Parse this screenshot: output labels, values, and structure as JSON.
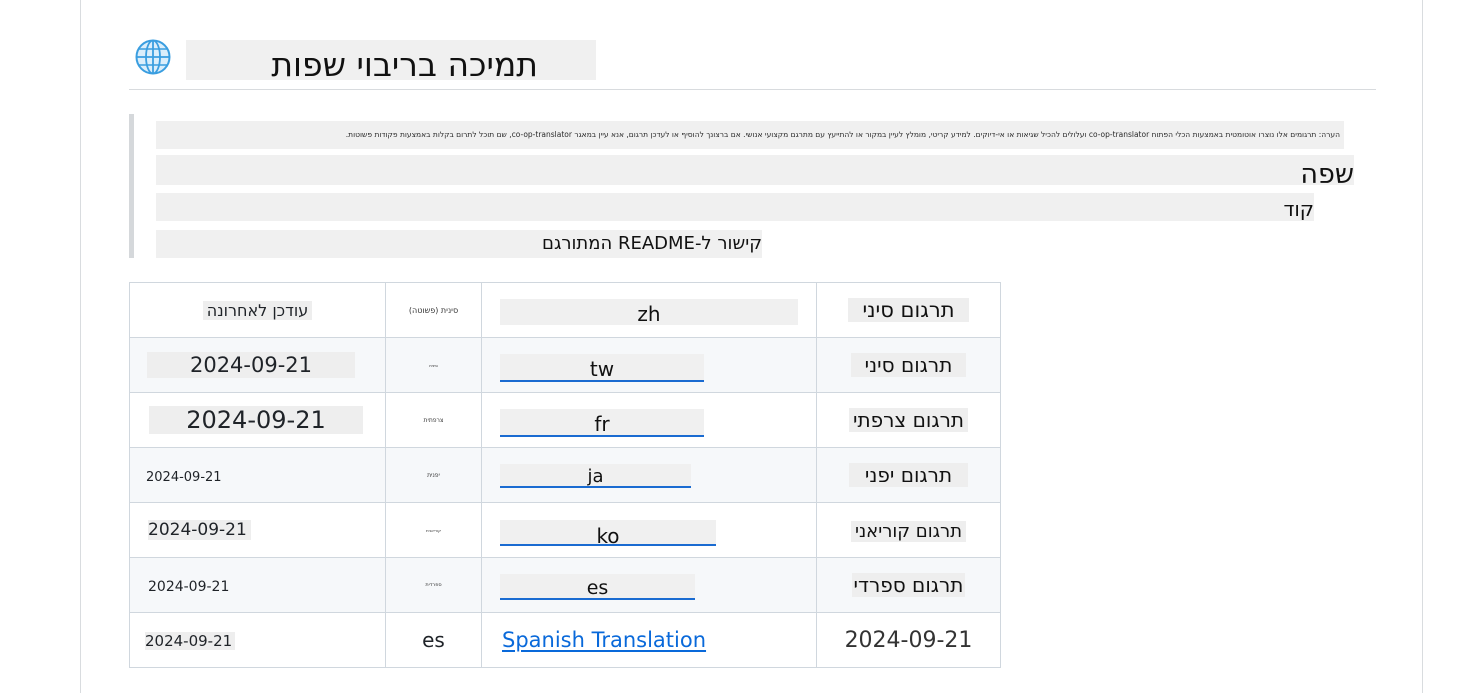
{
  "heading": {
    "icon": "globe-icon",
    "text": "תמיכה בריבוי שפות"
  },
  "note": "הערה: תרגומים אלו נוצרו אוטומטית באמצעות הכלי הפתוח co-op-translator ועלולים להכיל שגיאות או אי-דיוקים. למידע קריטי, מומלץ לעיין במקור או להתייעץ עם מתרגם מקצועי אנושי. אם ברצונך להוסיף או לעדכן תרגום, אנא עיין במאגר co-op-translator, שם תוכל לתרום בקלות באמצעות פקודות פשוטות.",
  "columns": {
    "language": "שפה",
    "code": "קוד",
    "link": "קישור ל-README המתורגם"
  },
  "table": {
    "header": {
      "updated": "עודכן לאחרונה",
      "tiny": "סינית (פשוטה)",
      "code": "zh",
      "name": "תרגום סיני"
    },
    "rows": [
      {
        "date": "2024-09-21",
        "tiny": "סינית",
        "code": "tw",
        "name": "תרגום סיני"
      },
      {
        "date": "2024-09-21",
        "tiny": "צרפתית",
        "code": "fr",
        "name": "תרגום צרפתי"
      },
      {
        "date": "2024-09-21",
        "tiny": "יפנית",
        "code": "ja",
        "name": "תרגום יפני"
      },
      {
        "date": "2024-09-21",
        "tiny": "קוריאנית",
        "code": "ko",
        "name": "תרגום קוריאני"
      },
      {
        "date": "2024-09-21",
        "tiny": "ספרדית",
        "code": "es",
        "name": "תרגום ספרדי"
      }
    ],
    "last": {
      "date": "2024-09-21",
      "code": "es",
      "link": "Spanish Translation",
      "updated": "2024-09-21"
    }
  },
  "colors": {
    "link": "#0969da",
    "border": "#d0d7de"
  }
}
